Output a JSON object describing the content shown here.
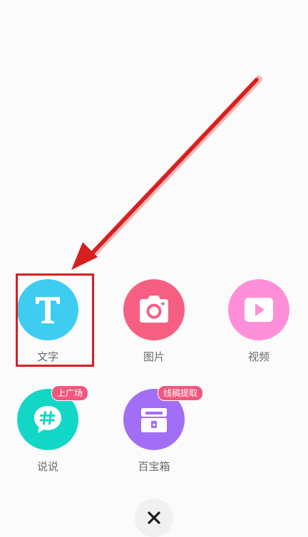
{
  "menu": {
    "items": [
      {
        "label": "文字",
        "icon": "text-t-icon",
        "color": "#3ecdf1"
      },
      {
        "label": "图片",
        "icon": "camera-icon",
        "color": "#f75f82"
      },
      {
        "label": "视频",
        "icon": "video-play-icon",
        "color": "#ff8fd8"
      },
      {
        "label": "说说",
        "icon": "hashtag-chat-icon",
        "color": "#12d7c7",
        "badge": "上广场"
      },
      {
        "label": "百宝箱",
        "icon": "treasure-box-icon",
        "color": "#a26ef6",
        "badge": "线稿提取"
      }
    ]
  },
  "annotation": {
    "highlight_color": "#d81f1f"
  },
  "close": {
    "icon": "close-icon"
  }
}
